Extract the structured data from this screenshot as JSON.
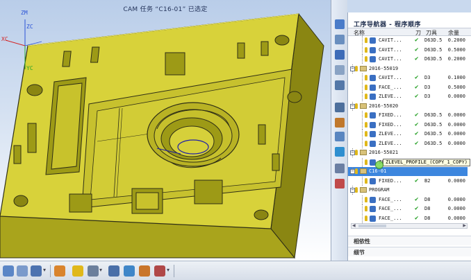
{
  "title": "CAM 任务 “C16-01” 已选定",
  "axes": {
    "zm": "ZM",
    "zc": "ZC",
    "xc": "XC",
    "yc": "YC"
  },
  "icon_strip": [
    "navigator-icon",
    "machine-tool-icon",
    "geometry-icon",
    "method-icon",
    "part-nav-icon",
    "history-icon",
    "tool-icon",
    "roles-icon",
    "web-icon",
    "assembly-icon",
    "palette-icon"
  ],
  "navigator": {
    "title": "工序导航器 - 程序顺序",
    "columns": {
      "name": "名称",
      "dao": "刀",
      "tool": "刀具",
      "stock": "余量"
    },
    "rows": [
      {
        "indent": 2,
        "kind": "op",
        "label": "CAVIT...",
        "check": "✔",
        "tool": "D63D.5",
        "stock": "0.2000"
      },
      {
        "indent": 2,
        "kind": "op",
        "label": "CAVIT...",
        "check": "✔",
        "tool": "D63D.5",
        "stock": "0.5000"
      },
      {
        "indent": 2,
        "kind": "op",
        "label": "CAVIT...",
        "check": "✔",
        "tool": "D63D.5",
        "stock": "0.2000"
      },
      {
        "indent": 1,
        "kind": "group",
        "label": "2016-55019",
        "check": "",
        "tool": "",
        "stock": ""
      },
      {
        "indent": 2,
        "kind": "op",
        "label": "CAVIT...",
        "check": "✔",
        "tool": "D3",
        "stock": "0.1000"
      },
      {
        "indent": 2,
        "kind": "op",
        "label": "FACE_...",
        "check": "✔",
        "tool": "D3",
        "stock": "0.5000"
      },
      {
        "indent": 2,
        "kind": "op",
        "label": "ZLEVE...",
        "check": "✔",
        "tool": "D3",
        "stock": "0.0000"
      },
      {
        "indent": 1,
        "kind": "group",
        "label": "2016-55020",
        "check": "",
        "tool": "",
        "stock": ""
      },
      {
        "indent": 2,
        "kind": "op",
        "label": "FIXED...",
        "check": "✔",
        "tool": "D63D.5",
        "stock": "0.0000"
      },
      {
        "indent": 2,
        "kind": "op",
        "label": "FIXED...",
        "check": "✔",
        "tool": "D63D.5",
        "stock": "0.0000"
      },
      {
        "indent": 2,
        "kind": "op",
        "label": "ZLEVE...",
        "check": "✔",
        "tool": "D63D.5",
        "stock": "0.0000"
      },
      {
        "indent": 2,
        "kind": "op",
        "label": "ZLEVE...",
        "check": "✔",
        "tool": "D63D.5",
        "stock": "0.0000"
      },
      {
        "indent": 1,
        "kind": "group",
        "label": "2016-55021",
        "check": "",
        "tool": "",
        "stock": ""
      },
      {
        "indent": 2,
        "kind": "op",
        "label": "ZLEVEL_PROFILE_(COPY_1_COPY)",
        "check": "",
        "tool": "",
        "stock": ""
      },
      {
        "indent": 1,
        "kind": "group",
        "label": "C16-01",
        "check": "",
        "tool": "",
        "stock": "",
        "selected": true
      },
      {
        "indent": 2,
        "kind": "op",
        "label": "FIXED...",
        "check": "✔",
        "tool": "B2",
        "stock": "0.0000"
      },
      {
        "indent": 1,
        "kind": "group",
        "label": "PROGRAM",
        "check": "",
        "tool": "",
        "stock": ""
      },
      {
        "indent": 2,
        "kind": "op",
        "label": "FACE_...",
        "check": "✔",
        "tool": "D8",
        "stock": "0.0000"
      },
      {
        "indent": 2,
        "kind": "op",
        "label": "FACE_...",
        "check": "✔",
        "tool": "D8",
        "stock": "0.0000"
      },
      {
        "indent": 2,
        "kind": "op",
        "label": "FACE_...",
        "check": "✔",
        "tool": "D8",
        "stock": "0.0000"
      }
    ],
    "tooltip": "ZLEVEL_PROFILE_(COPY_1_COPY)",
    "sections": {
      "dependencies": "相依性",
      "details": "细节"
    }
  },
  "colors": {
    "part": "#d8d23a",
    "part_dark": "#9d9a16",
    "outline": "#2e2e16",
    "selection": "#3c86de",
    "check": "#25a025"
  }
}
